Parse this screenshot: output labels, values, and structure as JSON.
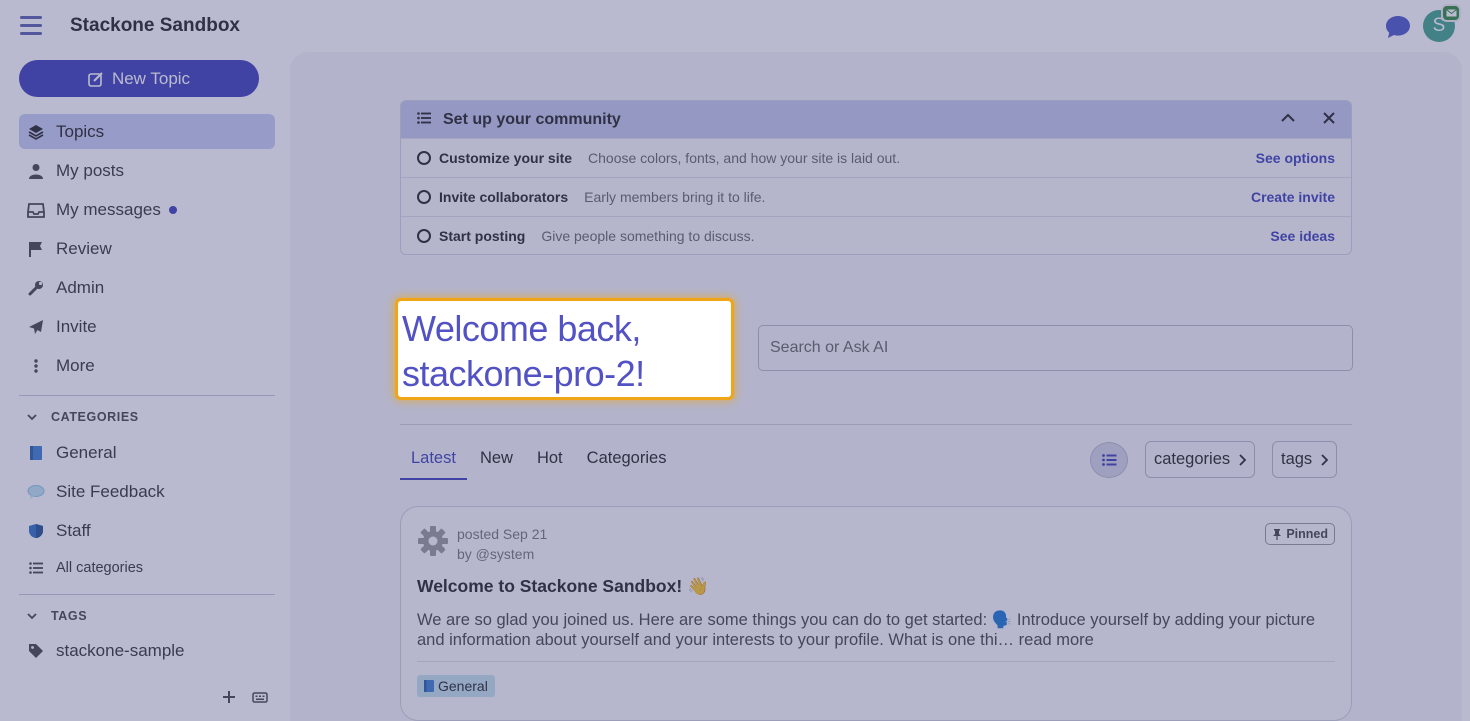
{
  "header": {
    "site_title": "Stackone Sandbox",
    "avatar_letter": "S"
  },
  "sidebar": {
    "new_topic_label": "New Topic",
    "nav": [
      {
        "label": "Topics",
        "icon": "layers-icon",
        "active": true
      },
      {
        "label": "My posts",
        "icon": "user-icon"
      },
      {
        "label": "My messages",
        "icon": "inbox-icon",
        "unread_dot": true
      },
      {
        "label": "Review",
        "icon": "flag-icon"
      },
      {
        "label": "Admin",
        "icon": "wrench-icon"
      },
      {
        "label": "Invite",
        "icon": "paper-plane-icon"
      },
      {
        "label": "More",
        "icon": "vertical-ellipsis-icon"
      }
    ],
    "categories_heading": "CATEGORIES",
    "categories": [
      {
        "label": "General",
        "icon": "book-emoji-icon"
      },
      {
        "label": "Site Feedback",
        "icon": "speech-bubble-emoji-icon"
      },
      {
        "label": "Staff",
        "icon": "shield-emoji-icon"
      },
      {
        "label": "All categories",
        "icon": "list-icon"
      }
    ],
    "tags_heading": "TAGS",
    "tags": [
      {
        "label": "stackone-sample",
        "icon": "tag-icon"
      }
    ]
  },
  "setup": {
    "title": "Set up your community",
    "rows": [
      {
        "title": "Customize your site",
        "desc": "Choose colors, fonts, and how your site is laid out.",
        "action": "See options"
      },
      {
        "title": "Invite collaborators",
        "desc": "Early members bring it to life.",
        "action": "Create invite"
      },
      {
        "title": "Start posting",
        "desc": "Give people something to discuss.",
        "action": "See ideas"
      }
    ]
  },
  "welcome": {
    "line1": "Welcome back,",
    "line2": "stackone-pro-2!"
  },
  "search": {
    "placeholder": "Search or Ask AI"
  },
  "tabs": [
    "Latest",
    "New",
    "Hot",
    "Categories"
  ],
  "filters": {
    "categories": "categories",
    "tags": "tags"
  },
  "topic": {
    "meta_line1": "posted Sep 21",
    "meta_line2": "by @system",
    "pinned": "Pinned",
    "title": "Welcome to Stackone Sandbox! 👋",
    "excerpt": "We are so glad you joined us. Here are some things you can do to get started: 🗣️ Introduce yourself by adding your picture and information about yourself and your interests to your profile. What is one thi… read more",
    "category": "General"
  },
  "colors": {
    "accent": "#3d3fb8",
    "highlight": "#f0a516",
    "active_nav": "#c9cdf2"
  }
}
